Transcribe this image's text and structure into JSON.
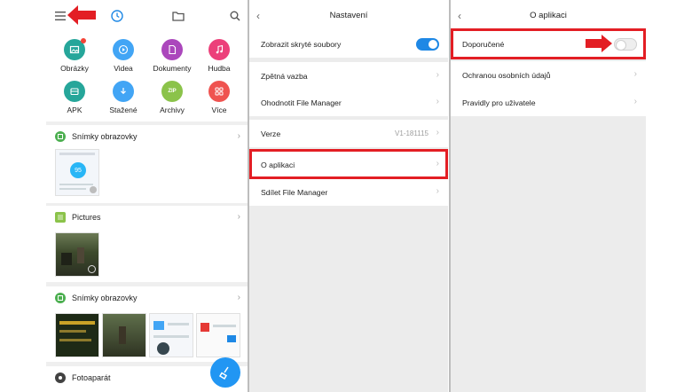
{
  "file_manager": {
    "categories": [
      {
        "label": "Obrázky",
        "color": "#26a69a",
        "icon": "image-icon"
      },
      {
        "label": "Videa",
        "color": "#42a5f5",
        "icon": "play-icon"
      },
      {
        "label": "Dokumenty",
        "color": "#ab47bc",
        "icon": "document-icon"
      },
      {
        "label": "Hudba",
        "color": "#ec407a",
        "icon": "music-icon"
      },
      {
        "label": "APK",
        "color": "#26a69a",
        "icon": "apk-icon"
      },
      {
        "label": "Stažené",
        "color": "#42a5f5",
        "icon": "download-icon"
      },
      {
        "label": "Archivy",
        "color": "#8bc34a",
        "icon": "zip-icon",
        "glyph": "ZIP"
      },
      {
        "label": "Více",
        "color": "#ef5350",
        "icon": "more-apps-icon"
      }
    ],
    "sections": [
      {
        "title": "Snímky obrazovky"
      },
      {
        "title": "Pictures"
      },
      {
        "title": "Snímky obrazovky"
      },
      {
        "title": "Fotoaparát"
      }
    ],
    "thumb_score": "95"
  },
  "settings": {
    "title": "Nastavení",
    "rows": [
      {
        "label": "Zobrazit skryté soubory"
      },
      {
        "label": "Zpětná vazba"
      },
      {
        "label": "Ohodnotit File Manager"
      },
      {
        "label": "Verze",
        "value": "V1-181115"
      },
      {
        "label": "O aplikaci"
      },
      {
        "label": "Sdílet File Manager"
      }
    ]
  },
  "about": {
    "title": "O aplikaci",
    "rows": [
      {
        "label": "Doporučené"
      },
      {
        "label": "Ochranou osobních údajů"
      },
      {
        "label": "Pravidly pro uživatele"
      }
    ]
  },
  "colors": {
    "accent": "#1e88e5",
    "highlight": "#e31e24"
  }
}
